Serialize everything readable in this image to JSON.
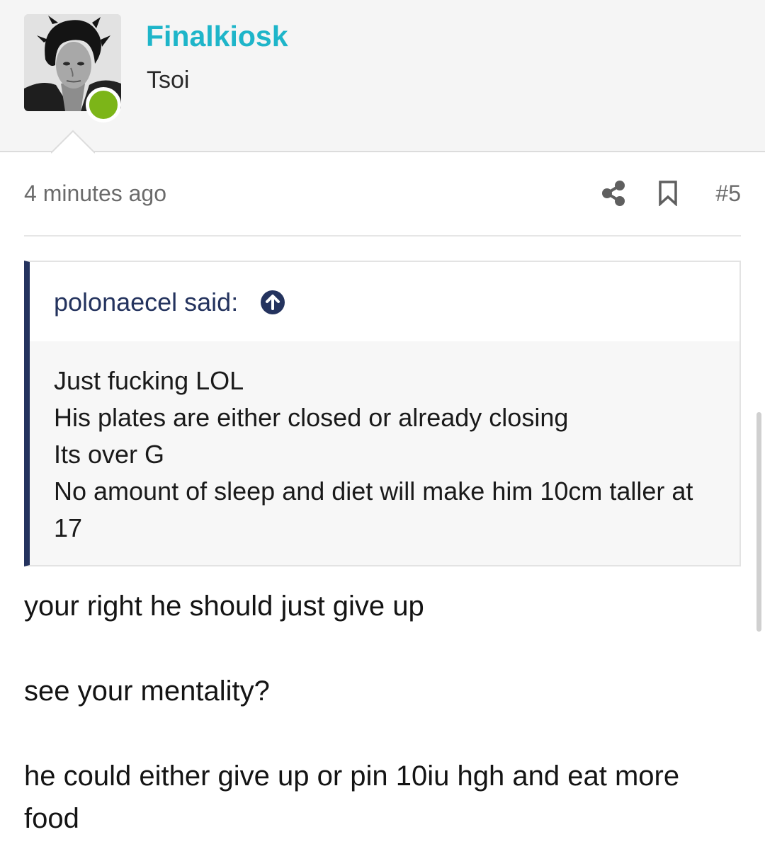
{
  "user": {
    "name": "Finalkiosk",
    "title": "Tsoi",
    "status_color": "#7cb518",
    "name_color": "#1eb5c9"
  },
  "post": {
    "timestamp": "4 minutes ago",
    "number": "#5",
    "actions": [
      "share-icon",
      "bookmark-icon"
    ]
  },
  "quote": {
    "author_line": "polonaecel said:",
    "accent_color": "#24335e",
    "lines": [
      "Just fucking LOL",
      "His plates are either closed or already closing",
      "Its over G",
      "No amount of sleep and diet will make him 10cm taller at 17"
    ]
  },
  "body": {
    "paragraphs": [
      "your right he should just give up",
      "see your mentality?",
      "he could either give up or pin 10iu hgh and eat more food"
    ]
  }
}
